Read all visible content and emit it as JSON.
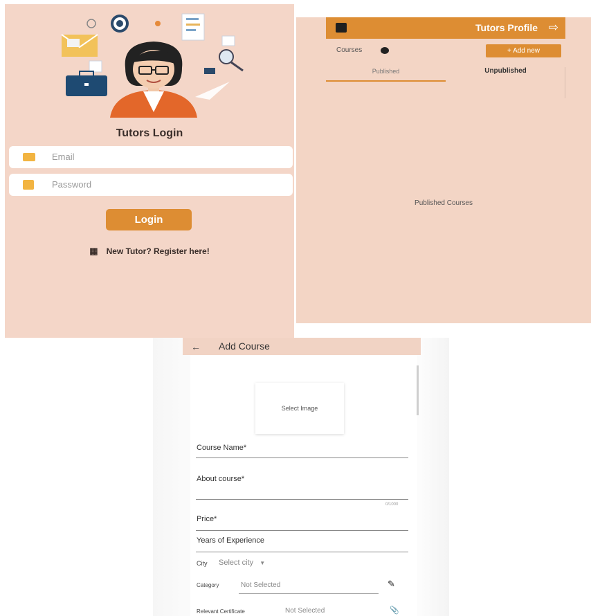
{
  "login": {
    "title": "Tutors Login",
    "email_placeholder": "Email",
    "password_placeholder": "Password",
    "login_button": "Login",
    "register_link": "New Tutor? Register here!"
  },
  "profile": {
    "header_title": "Tutors Profile",
    "courses_label": "Courses",
    "add_new": "+ Add new",
    "tabs": [
      {
        "label": "Published",
        "active": true
      },
      {
        "label": "Unpublished",
        "active": false
      }
    ],
    "empty_text": "Published Courses"
  },
  "add_course": {
    "header_title": "Add Course",
    "select_image": "Select Image",
    "course_name": "Course Name*",
    "about_course": "About course*",
    "about_counter": "0/1000",
    "price": "Price*",
    "experience": "Years of Experience",
    "city_label": "City",
    "city_value": "Select city",
    "category_label": "Category",
    "category_value": "Not Selected",
    "certificate_label": "Relevant Certificate",
    "certificate_value": "Not Selected"
  },
  "colors": {
    "accent": "#dd8d33",
    "panel_bg": "#f4d6c8",
    "header_bg": "#f1d3c4"
  },
  "icons": [
    "email-icon",
    "lock-icon",
    "register-icon",
    "user-icon",
    "logout-icon",
    "back-arrow-icon",
    "edit-icon",
    "attach-icon"
  ]
}
